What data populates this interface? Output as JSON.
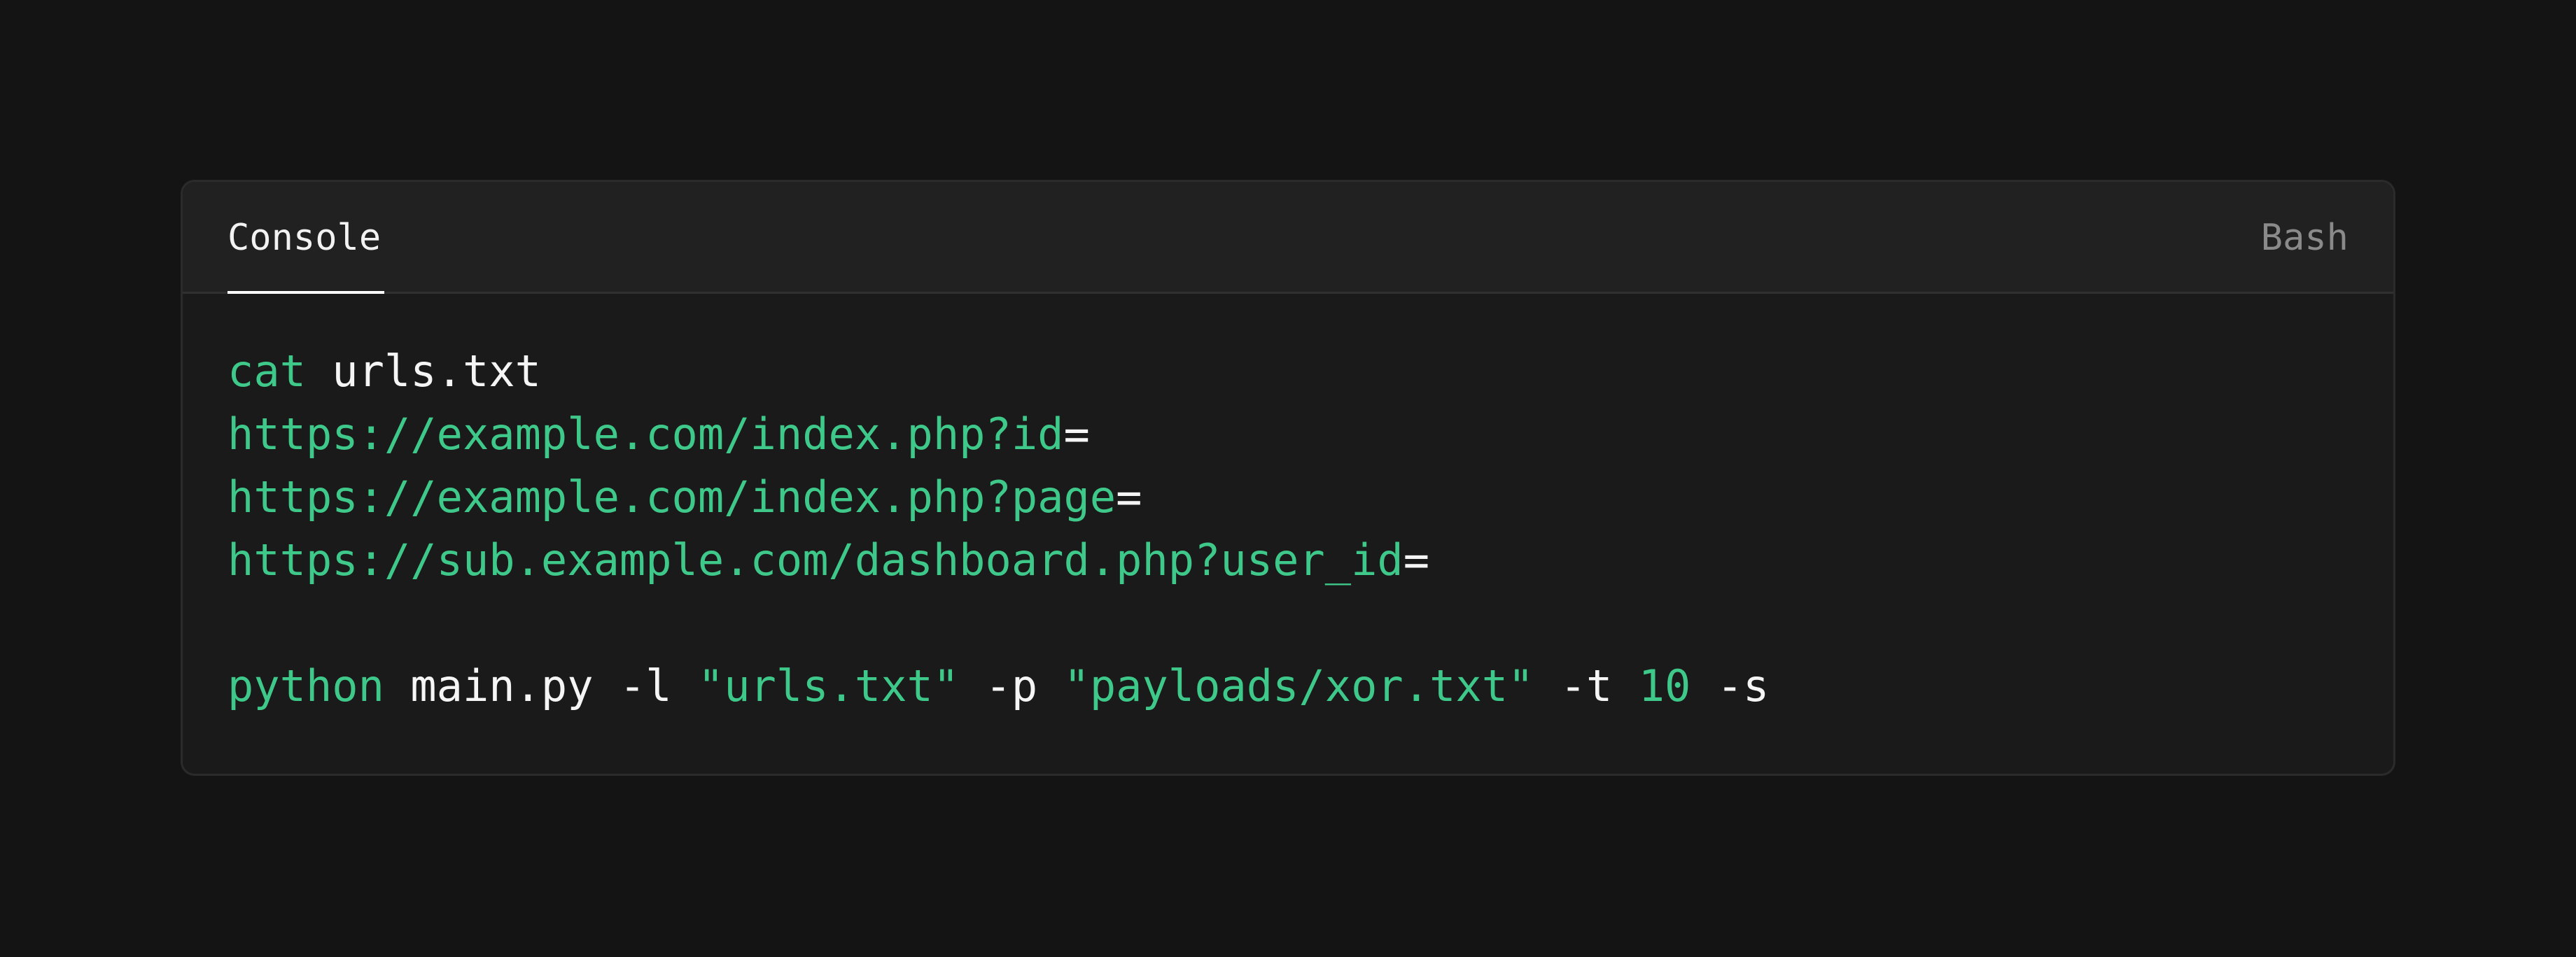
{
  "code_block": {
    "tab_label": "Console",
    "language_label": "Bash",
    "colors": {
      "page_background": "#141414",
      "window_background": "#1a1a1a",
      "header_background": "#212121",
      "accent_green": "#3ec98a",
      "text": "#f5f5f5",
      "muted": "#8a8a8a"
    },
    "lines": {
      "line1": {
        "cmd": "cat",
        "rest": " urls.txt"
      },
      "line2": {
        "url": "https://example.com/index.php?id",
        "eq": "="
      },
      "line3": {
        "url": "https://example.com/index.php?page",
        "eq": "="
      },
      "line4": {
        "url": "https://sub.example.com/dashboard.php?user_id",
        "eq": "="
      },
      "line6": {
        "cmd": "python",
        "part1": " main.py -l ",
        "str1": "\"urls.txt\"",
        "part2": " -p ",
        "str2": "\"payloads/xor.txt\"",
        "part3": " -t ",
        "num": "10",
        "part4": " -s"
      }
    }
  }
}
